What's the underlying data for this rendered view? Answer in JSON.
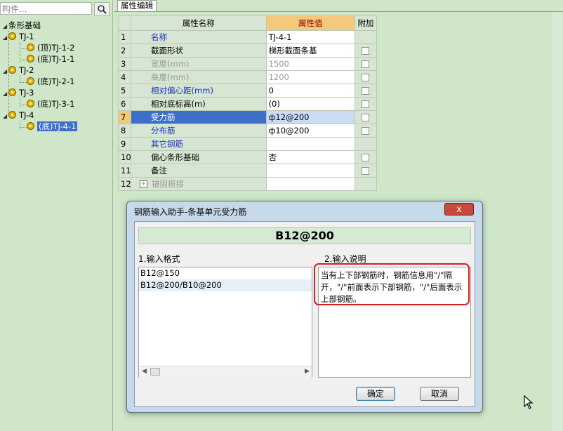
{
  "search": {
    "placeholder": "构件..."
  },
  "tree": {
    "root": "条形基础",
    "groups": [
      {
        "label": "TJ-1",
        "children": [
          "(顶)TJ-1-2",
          "(底)TJ-1-1"
        ]
      },
      {
        "label": "TJ-2",
        "children": [
          "(底)TJ-2-1"
        ]
      },
      {
        "label": "TJ-3",
        "children": [
          "(底)TJ-3-1"
        ]
      },
      {
        "label": "TJ-4",
        "children": [
          "(底)TJ-4-1"
        ]
      }
    ]
  },
  "tab": {
    "label": "属性编辑"
  },
  "grid": {
    "headers": [
      "属性名称",
      "属性值",
      "附加"
    ],
    "rows": [
      {
        "num": "1",
        "name": "名称",
        "value": "TJ-4-1"
      },
      {
        "num": "2",
        "name": "截面形状",
        "value": "梯形截面条基"
      },
      {
        "num": "3",
        "name": "宽度(mm)",
        "value": "1500"
      },
      {
        "num": "4",
        "name": "高度(mm)",
        "value": "1200"
      },
      {
        "num": "5",
        "name": "相对偏心距(mm)",
        "value": "0"
      },
      {
        "num": "6",
        "name": "相对底标高(m)",
        "value": "(0)"
      },
      {
        "num": "7",
        "name": "受力筋",
        "value": "ф12@200"
      },
      {
        "num": "8",
        "name": "分布筋",
        "value": "ф10@200"
      },
      {
        "num": "9",
        "name": "其它钢筋",
        "value": ""
      },
      {
        "num": "10",
        "name": "偏心条形基础",
        "value": "否"
      },
      {
        "num": "11",
        "name": "备注",
        "value": ""
      },
      {
        "num": "12",
        "name": "锚固搭接",
        "value": ""
      }
    ]
  },
  "dialog": {
    "title": "钢筋输入助手-条基单元受力筋",
    "close_label": "x",
    "preview": "B12@200",
    "format_label": "1.输入格式",
    "desc_label": "2.输入说明",
    "formats": [
      "B12@150",
      "B12@200/B10@200"
    ],
    "description": "当有上下部钢筋时，钢筋信息用\"/\"隔开，\"/\"前面表示下部钢筋，\"/\"后面表示上部钢筋。",
    "ok_label": "确定",
    "cancel_label": "取消"
  },
  "colors": {
    "panel_bg": "#cfe6c9",
    "header_value_bg": "#f5c97a",
    "selection": "#3c6fc8",
    "highlight_red": "#d41f1f"
  }
}
